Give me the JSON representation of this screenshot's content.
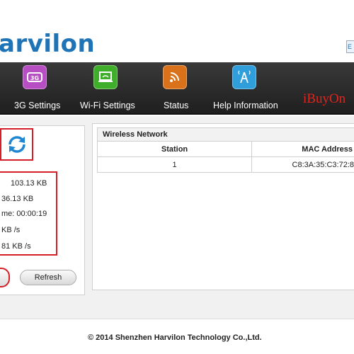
{
  "header": {
    "logo_text": "arvilon",
    "lang_label": "E"
  },
  "nav": {
    "items": [
      {
        "label": "3G Settings",
        "icon": "3g-icon",
        "color": "#b84ec4"
      },
      {
        "label": "Wi-Fi Settings",
        "icon": "wifi-settings-icon",
        "color": "#3fae2a"
      },
      {
        "label": "Status",
        "icon": "rss-status-icon",
        "color": "#d9721b"
      },
      {
        "label": "Help Information",
        "icon": "help-icon",
        "color": "#2f9edb"
      }
    ],
    "brand_mark": "iBuyOn"
  },
  "stats": {
    "sent": "103.13 KB",
    "received": "36.13 KB",
    "time": "me: 00:00:19",
    "upload_rate": "KB /s",
    "download_rate": "81 KB /s"
  },
  "buttons": {
    "refresh_label": "Refresh"
  },
  "wireless": {
    "title": "Wireless Network",
    "columns": [
      "Station",
      "MAC Address"
    ],
    "rows": [
      {
        "station": "1",
        "mac": "C8:3A:35:C3:72:8"
      }
    ]
  },
  "footer": {
    "copyright": "© 2014 Shenzhen Harvilon Technology Co.,Ltd."
  }
}
